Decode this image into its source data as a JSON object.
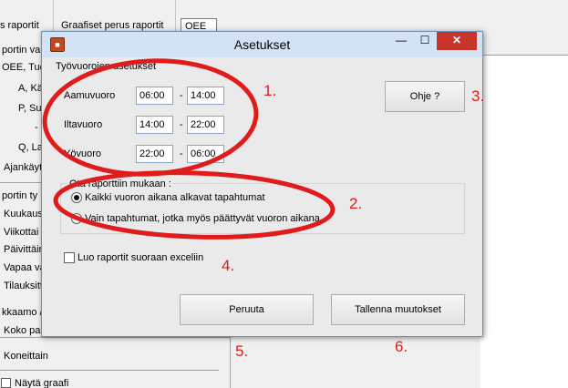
{
  "background": {
    "tabs": [
      "s raportit",
      "Graafiset perus raportit"
    ],
    "off_value": "OEE",
    "left_items": [
      "portin val",
      "OEE, Tuo",
      "A, Kä",
      "P, Su",
      "-",
      "Q, La",
      "Ajankäyt",
      "portin ty",
      "Kuukausi",
      "Viikottai",
      "Päivittäin",
      "Vapaa vä",
      "Tilauksitt",
      "kkaamo /",
      "Koko pak",
      "Koneittain",
      "Näytä graafi"
    ]
  },
  "dialog": {
    "title": "Asetukset",
    "close_glyph": "✕",
    "minimize_glyph": "—",
    "maximize_glyph": "☐",
    "section_title": "Työvuorojen asetukset",
    "shifts": [
      {
        "label": "Aamuvuoro",
        "start": "06:00",
        "end": "14:00"
      },
      {
        "label": "Iltavuoro",
        "start": "14:00",
        "end": "22:00"
      },
      {
        "label": "Yövuoro",
        "start": "22:00",
        "end": "06:00"
      }
    ],
    "dash": "-",
    "help_button": "Ohje ?",
    "report_group": {
      "title": "Ota raporttiin mukaan :",
      "options": [
        {
          "label": "Kaikki vuoron aikana alkavat tapahtumat",
          "selected": true
        },
        {
          "label": "Vain tapahtumat, jotka myös päättyvät vuoron aikana",
          "selected": false
        }
      ]
    },
    "excel_checkbox": {
      "label": "Luo raportit suoraan exceliin",
      "checked": false
    },
    "cancel_button": "Peruuta",
    "save_button": "Tallenna muutokset"
  },
  "annotations": {
    "labels": [
      "1.",
      "2.",
      "3.",
      "4.",
      "5.",
      "6."
    ],
    "color": "#e01b1b"
  }
}
